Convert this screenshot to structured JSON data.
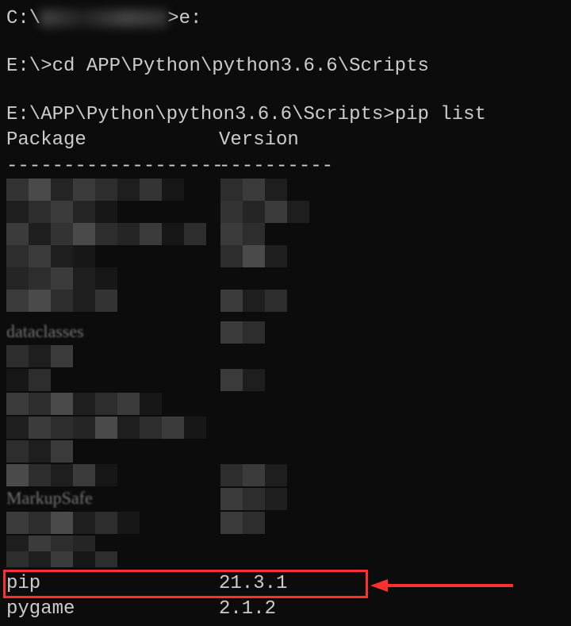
{
  "terminal": {
    "line1_prompt": "C:\\",
    "line1_cmd": ">e:",
    "line2": "E:\\>cd APP\\Python\\python3.6.6\\Scripts",
    "line3_prompt": "E:\\APP\\Python\\python3.6.6\\Scripts>",
    "line3_cmd": "pip list",
    "header_package": "Package",
    "header_version": "Version",
    "divider_package": "-------------------",
    "divider_version": "----------",
    "visible_partial1": "dataclasses",
    "visible_partial2": "MarkupSafe",
    "rows": [
      {
        "package": "pip",
        "version": "21.3.1"
      },
      {
        "package": "pygame",
        "version": "2.1.2"
      }
    ]
  }
}
